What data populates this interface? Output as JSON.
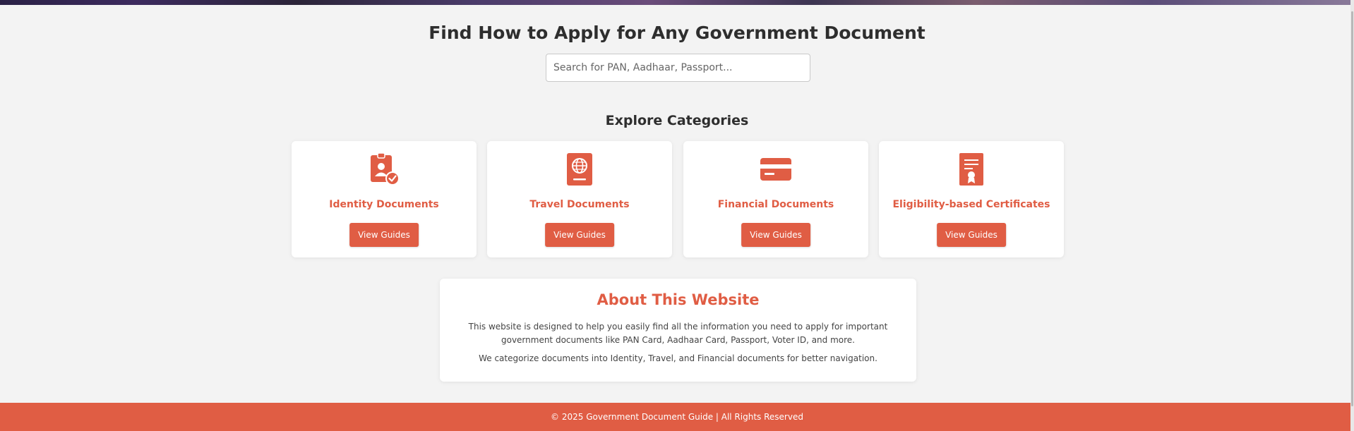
{
  "hero": {
    "title": "Find How to Apply for Any Government Document"
  },
  "search": {
    "placeholder": "Search for PAN, Aadhaar, Passport...",
    "value": ""
  },
  "categories": {
    "title": "Explore Categories",
    "items": [
      {
        "title": "Identity Documents",
        "button": "View Guides",
        "icon": "id-badge-check-icon"
      },
      {
        "title": "Travel Documents",
        "button": "View Guides",
        "icon": "passport-icon"
      },
      {
        "title": "Financial Documents",
        "button": "View Guides",
        "icon": "credit-card-icon"
      },
      {
        "title": "Eligibility-based Certificates",
        "button": "View Guides",
        "icon": "certificate-icon"
      }
    ]
  },
  "about": {
    "title": "About This Website",
    "paragraph1": "This website is designed to help you easily find all the information you need to apply for important government documents like PAN Card, Aadhaar Card, Passport, Voter ID, and more.",
    "paragraph2": "We categorize documents into Identity, Travel, and Financial documents for better navigation."
  },
  "footer": {
    "text": "© 2025 Government Document Guide | All Rights Reserved"
  },
  "colors": {
    "accent": "#e05d44",
    "background": "#f3f3f3",
    "card": "#ffffff"
  }
}
